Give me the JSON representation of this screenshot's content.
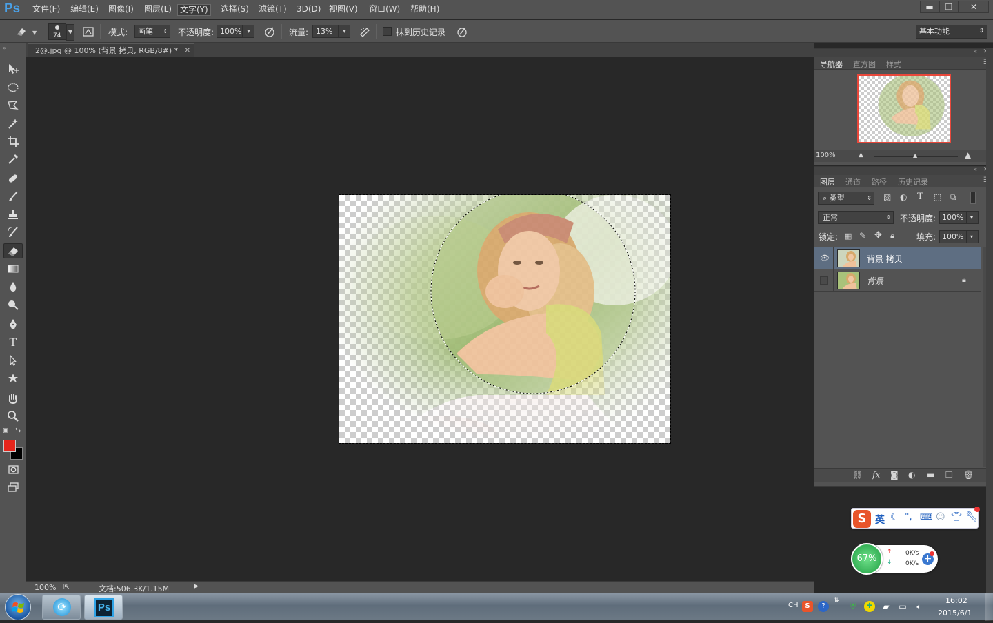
{
  "app": {
    "logo": "Ps",
    "accent": "#4aa0e6",
    "active_menu": "文字(Y)"
  },
  "menu": [
    "文件(F)",
    "编辑(E)",
    "图像(I)",
    "图层(L)",
    "文字(Y)",
    "选择(S)",
    "滤镜(T)",
    "3D(D)",
    "视图(V)",
    "窗口(W)",
    "帮助(H)"
  ],
  "window_buttons": {
    "minimize": "▬",
    "restore": "❐",
    "close": "✕"
  },
  "options": {
    "brush_size": "74",
    "mode_label": "模式:",
    "mode_value": "画笔",
    "opacity_label": "不透明度:",
    "opacity_value": "100%",
    "flow_label": "流量:",
    "flow_value": "13%",
    "erase_history_label": "抹到历史记录",
    "workspace": "基本功能"
  },
  "document": {
    "tab_title": "2@.jpg @ 100% (背景 拷贝, RGB/8#) *",
    "zoom": "100%",
    "doc_size": "文档:506.3K/1.15M"
  },
  "navigator": {
    "tabs": [
      "导航器",
      "直方图",
      "样式"
    ],
    "zoom": "100%"
  },
  "layers": {
    "tabs": [
      "图层",
      "通道",
      "路径",
      "历史记录"
    ],
    "filter_kind": "类型",
    "blend_mode": "正常",
    "opacity_label": "不透明度:",
    "opacity_value": "100%",
    "lock_label": "锁定:",
    "fill_label": "填充:",
    "fill_value": "100%",
    "items": [
      {
        "name": "背景 拷贝",
        "visible": true,
        "selected": true
      },
      {
        "name": "背景",
        "visible": false,
        "selected": false,
        "locked": true
      }
    ]
  },
  "colors": {
    "foreground": "#e5251b",
    "background": "#000000"
  },
  "ime": {
    "label": "英"
  },
  "net_widget": {
    "cpu": "67%",
    "up": "0K/s",
    "down": "0K/s"
  },
  "taskbar": {
    "lang": "CH",
    "time": "16:02",
    "date": "2015/6/1"
  }
}
